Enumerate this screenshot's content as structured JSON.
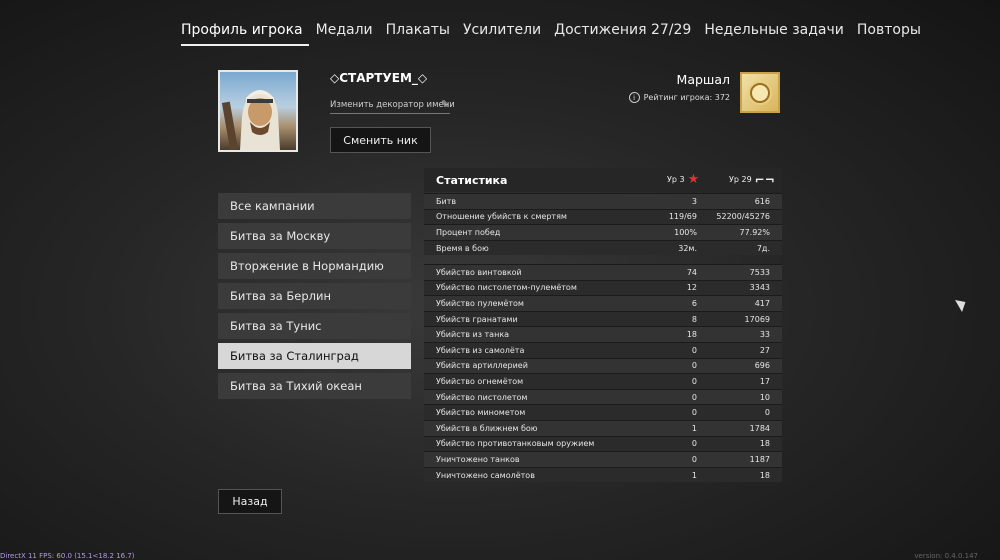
{
  "tabs": [
    {
      "label": "Профиль игрока",
      "active": true
    },
    {
      "label": "Медали"
    },
    {
      "label": "Плакаты"
    },
    {
      "label": "Усилители"
    },
    {
      "label": "Достижения 27/29"
    },
    {
      "label": "Недельные задачи"
    },
    {
      "label": "Повторы"
    }
  ],
  "profile": {
    "nickname": "◇СТАРТУЕМ_◇",
    "decorator_link": "Изменить декоратор имени",
    "change_nick_button": "Сменить ник",
    "rank_title": "Маршал",
    "rating_label": "Рейтинг игрока: 372"
  },
  "campaigns": [
    {
      "label": "Все кампании"
    },
    {
      "label": "Битва за Москву"
    },
    {
      "label": "Вторжение в Нормандию"
    },
    {
      "label": "Битва за Берлин"
    },
    {
      "label": "Битва за Тунис"
    },
    {
      "label": "Битва за Сталинград",
      "active": true
    },
    {
      "label": "Битва за Тихий океан"
    }
  ],
  "stats": {
    "title": "Статистика",
    "level1": "Ур 3",
    "level2": "Ур 29",
    "general": [
      [
        "Битв",
        "3",
        "616"
      ],
      [
        "Отношение убийств к смертям",
        "119/69",
        "52200/45276"
      ],
      [
        "Процент побед",
        "100%",
        "77.92%"
      ],
      [
        "Время в бою",
        "32м.",
        "7д."
      ]
    ],
    "kills": [
      [
        "Убийство винтовкой",
        "74",
        "7533"
      ],
      [
        "Убийство пистолетом-пулемётом",
        "12",
        "3343"
      ],
      [
        "Убийство пулемётом",
        "6",
        "417"
      ],
      [
        "Убийств гранатами",
        "8",
        "17069"
      ],
      [
        "Убийств из танка",
        "18",
        "33"
      ],
      [
        "Убийств из самолёта",
        "0",
        "27"
      ],
      [
        "Убийств артиллерией",
        "0",
        "696"
      ],
      [
        "Убийство огнемётом",
        "0",
        "17"
      ],
      [
        "Убийство пистолетом",
        "0",
        "10"
      ],
      [
        "Убийство минометом",
        "0",
        "0"
      ],
      [
        "Убийств в ближнем бою",
        "1",
        "1784"
      ],
      [
        "Убийство противотанковым оружием",
        "0",
        "18"
      ],
      [
        "Уничтожено танков",
        "0",
        "1187"
      ],
      [
        "Уничтожено самолётов",
        "1",
        "18"
      ]
    ]
  },
  "back_button": "Назад",
  "fps_overlay": "DirectX 11 FPS: 60.0 (15.1<18.2 16.7)",
  "version": "version: 0.4.0.147",
  "colors": {
    "active_tab_underline": "#f0f0f0",
    "active_campaign_bg": "#d7d7d7",
    "rank_badge_gold": "#d9b45c",
    "star_red": "#d33333"
  }
}
